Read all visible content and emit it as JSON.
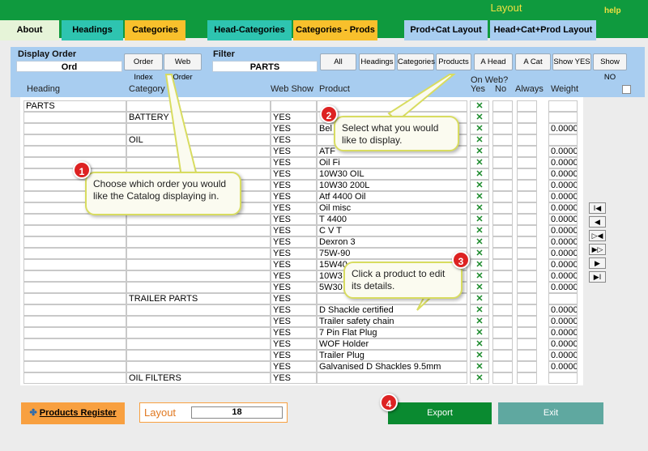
{
  "window": {
    "title": "Layout",
    "help_label": "help"
  },
  "top_tabs": [
    {
      "label": "About",
      "bg": "#e6f4d8"
    },
    {
      "label": "Headings",
      "bg": "#2ec4b0"
    },
    {
      "label": "Categories",
      "bg": "#f8c02c"
    },
    {
      "label": "Head-Categories",
      "bg": "#2ec4b0"
    },
    {
      "label": "Categories - Prods",
      "bg": "#f8c02c"
    },
    {
      "label": "Prod+Cat Layout",
      "bg": "#a8cdf0"
    },
    {
      "label": "Head+Cat+Prod Layout",
      "bg": "#a8cdf0"
    }
  ],
  "display_order": {
    "label": "Display Order",
    "value": "Ord",
    "order_index_label": "Order Index",
    "web_order_label": "Web Order"
  },
  "filter": {
    "label": "Filter",
    "value": "PARTS",
    "buttons": [
      "All",
      "Headings",
      "Categories",
      "Products",
      "A Head",
      "A Cat",
      "Show YES",
      "Show NO"
    ]
  },
  "columns": {
    "heading": "Heading",
    "category": "Category",
    "web_show": "Web Show",
    "product": "Product",
    "on_web": "On Web?",
    "yes": "Yes",
    "no": "No",
    "always": "Always",
    "weight": "Weight"
  },
  "rows": [
    {
      "heading": "PARTS",
      "category": "",
      "web": "",
      "product": "",
      "yes": "✕",
      "weight": ""
    },
    {
      "heading": "",
      "category": "BATTERY",
      "web": "YES",
      "product": "",
      "yes": "✕",
      "weight": ""
    },
    {
      "heading": "",
      "category": "",
      "web": "YES",
      "product": "Bel",
      "yes": "✕",
      "weight": "0.0000"
    },
    {
      "heading": "",
      "category": "OIL",
      "web": "YES",
      "product": "",
      "yes": "✕",
      "weight": ""
    },
    {
      "heading": "",
      "category": "",
      "web": "YES",
      "product": "ATF",
      "yes": "✕",
      "weight": "0.0000"
    },
    {
      "heading": "",
      "category": "",
      "web": "YES",
      "product": "Oil Fi",
      "yes": "✕",
      "weight": "0.0000"
    },
    {
      "heading": "",
      "category": "",
      "web": "YES",
      "product": "10W30 OIL",
      "yes": "✕",
      "weight": "0.0000"
    },
    {
      "heading": "",
      "category": "",
      "web": "YES",
      "product": "10W30 200L",
      "yes": "✕",
      "weight": "0.0000"
    },
    {
      "heading": "",
      "category": "",
      "web": "YES",
      "product": "Atf 4400 Oil",
      "yes": "✕",
      "weight": "0.0000"
    },
    {
      "heading": "",
      "category": "",
      "web": "YES",
      "product": "Oil misc",
      "yes": "✕",
      "weight": "0.0000"
    },
    {
      "heading": "",
      "category": "",
      "web": "YES",
      "product": "T 4400",
      "yes": "✕",
      "weight": "0.0000"
    },
    {
      "heading": "",
      "category": "",
      "web": "YES",
      "product": "C V T",
      "yes": "✕",
      "weight": "0.0000"
    },
    {
      "heading": "",
      "category": "",
      "web": "YES",
      "product": "Dexron 3",
      "yes": "✕",
      "weight": "0.0000"
    },
    {
      "heading": "",
      "category": "",
      "web": "YES",
      "product": "75W-90",
      "yes": "✕",
      "weight": "0.0000"
    },
    {
      "heading": "",
      "category": "",
      "web": "YES",
      "product": "15W40",
      "yes": "✕",
      "weight": "0.0000"
    },
    {
      "heading": "",
      "category": "",
      "web": "YES",
      "product": "10W3",
      "yes": "✕",
      "weight": "0.0000"
    },
    {
      "heading": "",
      "category": "",
      "web": "YES",
      "product": "5W30",
      "yes": "✕",
      "weight": "0.0000"
    },
    {
      "heading": "",
      "category": "TRAILER PARTS",
      "web": "YES",
      "product": "",
      "yes": "✕",
      "weight": ""
    },
    {
      "heading": "",
      "category": "",
      "web": "YES",
      "product": "D Shackle certified",
      "yes": "✕",
      "weight": "0.0000"
    },
    {
      "heading": "",
      "category": "",
      "web": "YES",
      "product": "Trailer safety chain",
      "yes": "✕",
      "weight": "0.0000"
    },
    {
      "heading": "",
      "category": "",
      "web": "YES",
      "product": "7 Pin Flat Plug",
      "yes": "✕",
      "weight": "0.0000"
    },
    {
      "heading": "",
      "category": "",
      "web": "YES",
      "product": "WOF Holder",
      "yes": "✕",
      "weight": "0.0000"
    },
    {
      "heading": "",
      "category": "",
      "web": "YES",
      "product": "Trailer Plug",
      "yes": "✕",
      "weight": "0.0000"
    },
    {
      "heading": "",
      "category": "",
      "web": "YES",
      "product": "Galvanised D Shackles 9.5mm",
      "yes": "✕",
      "weight": "0.0000"
    },
    {
      "heading": "",
      "category": "OIL FILTERS",
      "web": "YES",
      "product": "",
      "yes": "✕",
      "weight": ""
    }
  ],
  "nav_buttons": [
    "I◀",
    "◀",
    "▷◀",
    "▶▷",
    "▶",
    "▶I"
  ],
  "callouts": [
    {
      "number": "1",
      "text": "Choose which order you would like the Catalog displaying in."
    },
    {
      "number": "2",
      "text": "Select what you would like to display."
    },
    {
      "number": "3",
      "text": "Click a product to edit its details."
    },
    {
      "number": "4",
      "text": ""
    }
  ],
  "footer": {
    "products_register_label": "Products Register",
    "layout_label": "Layout",
    "layout_value": "18",
    "export_label": "Export",
    "exit_label": "Exit"
  },
  "colors": {
    "green_bar": "#0f9a3e",
    "filter_bg": "#a8cdf0",
    "export_bg": "#0a8a30",
    "exit_bg": "#5fa8a0",
    "register_bg": "#f8a040",
    "check": "#1a8a2a"
  }
}
